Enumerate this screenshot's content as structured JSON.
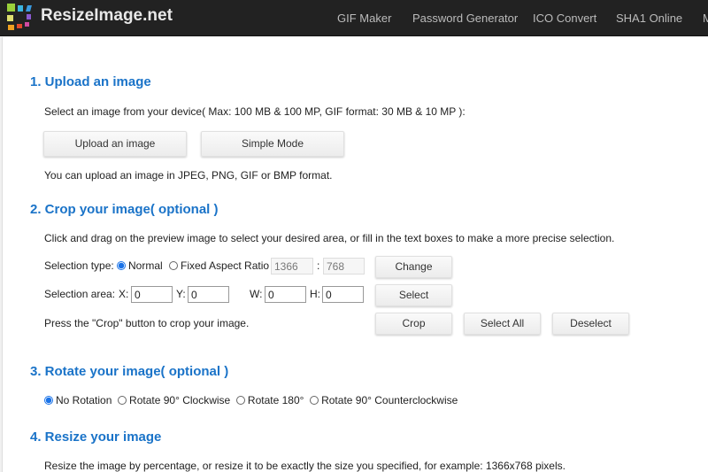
{
  "header": {
    "brand": "ResizeImage.net",
    "nav": [
      "GIF Maker",
      "Password Generator",
      "ICO Convert",
      "SHA1 Online",
      "M"
    ]
  },
  "upload": {
    "title": "1. Upload an image",
    "desc": "Select an image from your device( Max: 100 MB & 100 MP, GIF format: 30 MB & 10 MP ):",
    "upload_btn": "Upload an image",
    "simple_btn": "Simple Mode",
    "formats": "You can upload an image in JPEG, PNG, GIF or BMP format."
  },
  "crop": {
    "title": "2. Crop your image( optional )",
    "desc": "Click and drag on the preview image to select your desired area, or fill in the text boxes to make a more precise selection.",
    "sel_type_label": "Selection type:",
    "normal": "Normal",
    "fixed": "Fixed Aspect Ratio",
    "ratio_w": "1366",
    "colon": ":",
    "ratio_h": "768",
    "change_btn": "Change",
    "sel_area_label": "Selection area:",
    "x_label": "X:",
    "x": "0",
    "y_label": "Y:",
    "y": "0",
    "w_label": "W:",
    "w": "0",
    "h_label": "H:",
    "h": "0",
    "select_btn": "Select",
    "press": "Press the \"Crop\" button to crop your image.",
    "crop_btn": "Crop",
    "select_all_btn": "Select All",
    "deselect_btn": "Deselect"
  },
  "rotate": {
    "title": "3. Rotate your image( optional )",
    "options": [
      "No Rotation",
      "Rotate 90° Clockwise",
      "Rotate 180°",
      "Rotate 90° Counterclockwise"
    ],
    "selected": "No Rotation"
  },
  "resize": {
    "title": "4. Resize your image",
    "desc": "Resize the image by percentage, or resize it to be exactly the size you specified, for example: 1366x768 pixels."
  }
}
